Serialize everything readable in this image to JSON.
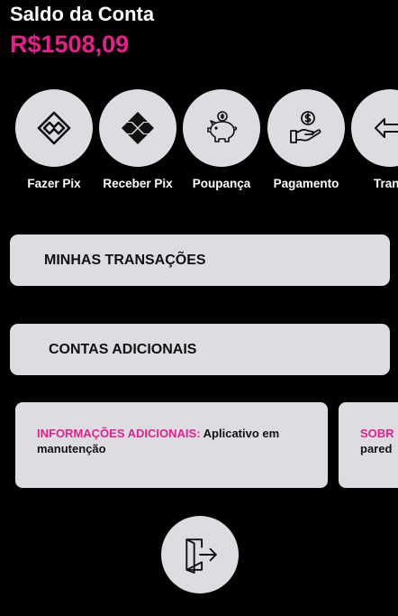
{
  "balance": {
    "label": "Saldo da Conta",
    "value": "R$1508,09"
  },
  "actions": [
    {
      "label": "Fazer Pix",
      "icon": "pix-icon"
    },
    {
      "label": "Receber Pix",
      "icon": "pix-filled-icon"
    },
    {
      "label": "Poupança",
      "icon": "piggy-bank-icon"
    },
    {
      "label": "Pagamento",
      "icon": "hand-money-icon"
    },
    {
      "label": "Trans",
      "icon": "transfer-arrow-icon"
    }
  ],
  "menu": {
    "transactions_label": "MINHAS TRANSAÇÕES",
    "accounts_label": "CONTAS ADICIONAIS"
  },
  "cards": [
    {
      "title": "INFORMAÇÕES ADICIONAIS:",
      "text": " Aplicativo em manutenção"
    },
    {
      "title": "SOBR",
      "text": "pared"
    }
  ],
  "logout": {
    "icon": "logout-door-icon"
  },
  "colors": {
    "background": "#000000",
    "accent": "#e91e8c",
    "surface": "#dcdde1"
  }
}
